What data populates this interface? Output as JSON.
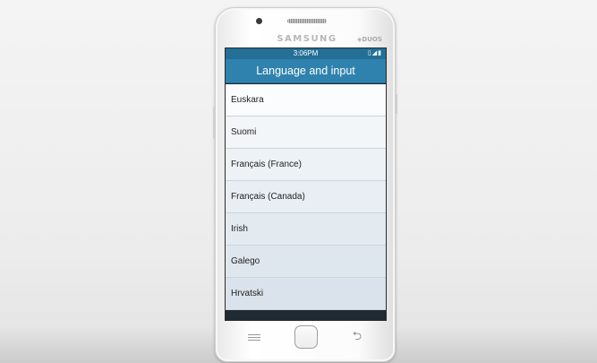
{
  "device": {
    "brand": "SAMSUNG",
    "duos_label": "DUOS"
  },
  "status_bar": {
    "time": "3:06PM",
    "icons": [
      "sim-icon",
      "signal-icon",
      "battery-icon"
    ]
  },
  "app_bar": {
    "title": "Language and input"
  },
  "languages": [
    {
      "label": "Euskara"
    },
    {
      "label": "Suomi"
    },
    {
      "label": "Français (France)"
    },
    {
      "label": "Français (Canada)"
    },
    {
      "label": "Irish"
    },
    {
      "label": "Galego"
    },
    {
      "label": "Hrvatski"
    }
  ],
  "colors": {
    "status_bar": "#236f97",
    "app_bar": "#2f82ad",
    "list_text": "#1e1e1e"
  },
  "hardware_keys": [
    "menu-key",
    "home-key",
    "back-key"
  ]
}
